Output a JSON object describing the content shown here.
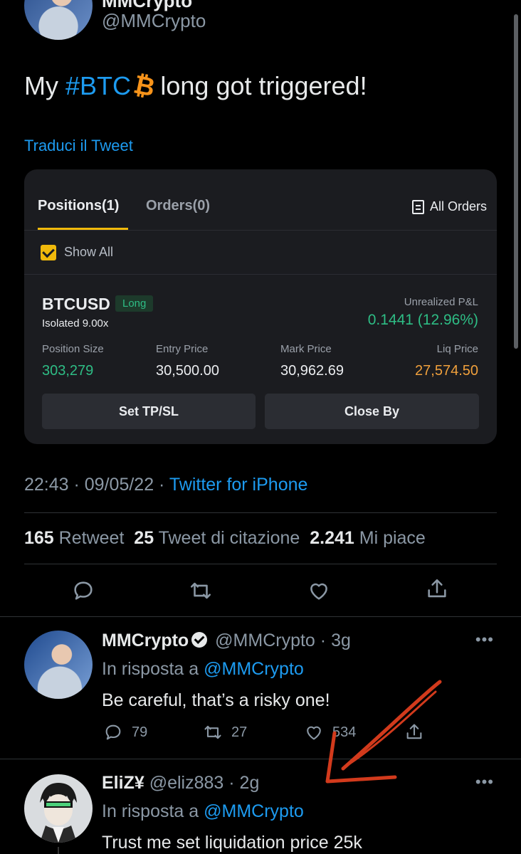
{
  "author": {
    "name": "MMCrypto",
    "handle": "@MMCrypto"
  },
  "tweet": {
    "text_before": "My ",
    "hashtag": "#BTC",
    "emoji": "₿",
    "text_after": "long got triggered!",
    "translate": "Traduci il Tweet"
  },
  "card": {
    "tab_positions": "Positions(1)",
    "tab_orders": "Orders(0)",
    "all_orders": "All Orders",
    "show_all": "Show All",
    "symbol": "BTCUSD",
    "side": "Long",
    "margin_mode": "Isolated 9.00x",
    "upnl_label": "Unrealized P&L",
    "upnl_value": "0.1441 (12.96%)",
    "fields": [
      {
        "label": "Position Size",
        "value": "303,279"
      },
      {
        "label": "Entry Price",
        "value": "30,500.00"
      },
      {
        "label": "Mark Price",
        "value": "30,962.69"
      },
      {
        "label": "Liq Price",
        "value": "27,574.50"
      }
    ],
    "btn_tpsl": "Set TP/SL",
    "btn_close": "Close By"
  },
  "meta": {
    "time": "22:43",
    "sep": " · ",
    "date": "09/05/22",
    "client": "Twitter for iPhone"
  },
  "stats": {
    "retweets": "165",
    "retweets_label": "Retweet",
    "quotes": "25",
    "quotes_label": "Tweet di citazione",
    "likes": "2.241",
    "likes_label": "Mi piace"
  },
  "replies": [
    {
      "name": "MMCrypto",
      "handle": "@MMCrypto",
      "time": "· 3g",
      "reply_prefix": "In risposta a",
      "reply_to": "@MMCrypto",
      "text": "Be careful, that’s a risky one!",
      "replies": "79",
      "retweets": "27",
      "likes": "534"
    },
    {
      "name": "EliZ¥",
      "handle": "@eliz883",
      "time": "· 2g",
      "reply_prefix": "In risposta a",
      "reply_to": "@MMCrypto",
      "text": "Trust me set liquidation price 25k"
    }
  ],
  "colors": {
    "accent": "#1d9bf0",
    "profit": "#2ebd85",
    "tab_indicator": "#f0b90b",
    "annotation_arrow": "#d23a1c"
  },
  "icons": [
    "reply-icon",
    "retweet-icon",
    "like-icon",
    "share-icon",
    "verified-icon",
    "more-icon",
    "document-icon"
  ]
}
